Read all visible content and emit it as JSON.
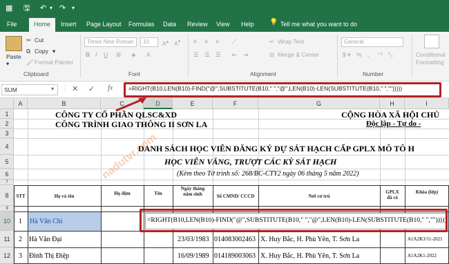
{
  "ribbon_tabs": [
    "File",
    "Home",
    "Insert",
    "Page Layout",
    "Formulas",
    "Data",
    "Review",
    "View",
    "Help"
  ],
  "tell_me": "Tell me what you want to do",
  "clipboard": {
    "paste": "Paste",
    "cut": "Cut",
    "copy": "Copy",
    "format_painter": "Format Painter",
    "group": "Clipboard"
  },
  "font": {
    "name": "Times New Roman",
    "size": "10",
    "group": "Font"
  },
  "alignment": {
    "wrap": "Wrap Text",
    "merge": "Merge & Center",
    "group": "Alignment"
  },
  "number": {
    "format": "General",
    "group": "Number"
  },
  "styles": {
    "conditional": "Conditional Formatting"
  },
  "name_box": "SUM",
  "formula": "=RIGHT(B10,LEN(B10)-FIND(\"@\",SUBSTITUTE(B10,\" \",\"@\",LEN(B10)-LEN(SUBSTITUTE(B10,\" \",\"\")))))",
  "columns": [
    "A",
    "B",
    "C",
    "D",
    "E",
    "F",
    "G",
    "H",
    "I"
  ],
  "rows": [
    "1",
    "2",
    "3",
    "4",
    "5",
    "6",
    "7",
    "8",
    "9",
    "10",
    "11",
    "12"
  ],
  "sheet": {
    "company": "CÔNG TY CỔ PHẦN QLSC&XD",
    "project": "CÔNG TRÌNH GIAO THÔNG II SƠN LA",
    "nation": "CỘNG HÒA XÃ HỘI CHỦ",
    "motto": "Độc lập - Tự do -",
    "title": "DANH SÁCH HỌC VIÊN ĐĂNG KÝ DỰ SÁT HẠCH CẤP GPLX MÔ TÔ H",
    "subtitle": "HỌC VIÊN VẮNG, TRƯỢT CÁC KỲ SÁT HẠCH",
    "note": "(Kèm theo Tờ trình số: 268/BC-CTY2 ngày 06 tháng  5 năm 2022)",
    "watermark": "nadutvr.com",
    "headers": {
      "stt": "STT",
      "hoten": "Họ và tên",
      "hodem": "Họ đệm",
      "ten": "Tên",
      "ngaysinh": "Ngày tháng năm sinh",
      "cmnd": "Số CMND/ CCCD",
      "noicutru": "Nơi cư trú",
      "gplx": "GPLX đã có",
      "khoa": "Khóa (lớp)"
    },
    "records": [
      {
        "stt": "1",
        "name": "Hà Văn Chi",
        "dob": "",
        "id": "",
        "addr": "",
        "course": ""
      },
      {
        "stt": "2",
        "name": "Hà Văn Đại",
        "dob": "23/03/1983",
        "id": "014083002463",
        "addr": "X. Huy Bắc, H. Phù Yên, T. Sơn La",
        "course": "A1A2K3/11-2021"
      },
      {
        "stt": "3",
        "name": "Đinh Thị Điệp",
        "dob": "16/09/1989",
        "id": "014189003063",
        "addr": "X. Huy Bắc, H. Phù Yên, T. Sơn La",
        "course": "A1A2K1-2022"
      }
    ]
  }
}
